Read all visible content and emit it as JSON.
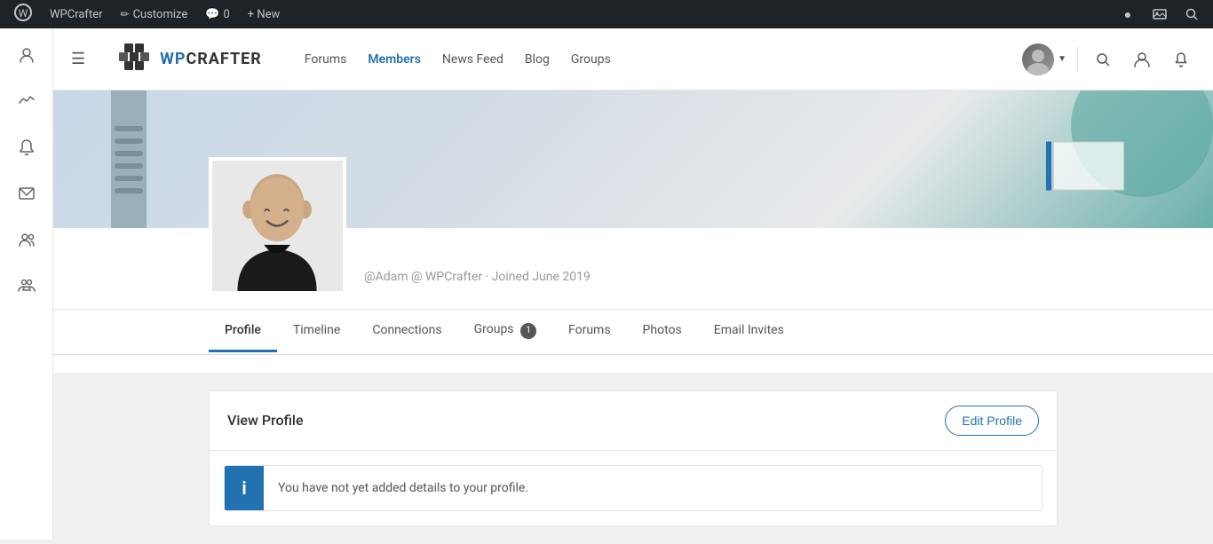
{
  "admin_bar": {
    "wp_logo": "⊞",
    "site_name": "WPCrafter",
    "customize_label": "Customize",
    "comments_label": "0",
    "new_label": "+ New",
    "right_icons": [
      "●",
      "🖼",
      "🔍"
    ]
  },
  "sidebar": {
    "icons": [
      {
        "name": "user-icon",
        "symbol": "👤"
      },
      {
        "name": "activity-icon",
        "symbol": "⚡"
      },
      {
        "name": "notification-icon",
        "symbol": "🔔"
      },
      {
        "name": "message-icon",
        "symbol": "✉"
      },
      {
        "name": "members-icon",
        "symbol": "👥"
      },
      {
        "name": "groups-icon",
        "symbol": "👥"
      }
    ]
  },
  "top_nav": {
    "hamburger": "☰",
    "logo_text": "WPCRAFTER",
    "links": [
      {
        "label": "Forums",
        "active": false
      },
      {
        "label": "Members",
        "active": true
      },
      {
        "label": "News Feed",
        "active": false
      },
      {
        "label": "Blog",
        "active": false
      },
      {
        "label": "Groups",
        "active": false
      }
    ]
  },
  "profile": {
    "username": "@Adam @ WPCrafter · Joined June 2019",
    "tabs": [
      {
        "label": "Profile",
        "active": true,
        "badge": null
      },
      {
        "label": "Timeline",
        "active": false,
        "badge": null
      },
      {
        "label": "Connections",
        "active": false,
        "badge": null
      },
      {
        "label": "Groups",
        "active": false,
        "badge": "1"
      },
      {
        "label": "Forums",
        "active": false,
        "badge": null
      },
      {
        "label": "Photos",
        "active": false,
        "badge": null
      },
      {
        "label": "Email Invites",
        "active": false,
        "badge": null
      }
    ]
  },
  "view_profile": {
    "title": "View Profile",
    "edit_button": "Edit Profile",
    "notice_icon": "i",
    "notice_text": "You have not yet added details to your profile."
  }
}
